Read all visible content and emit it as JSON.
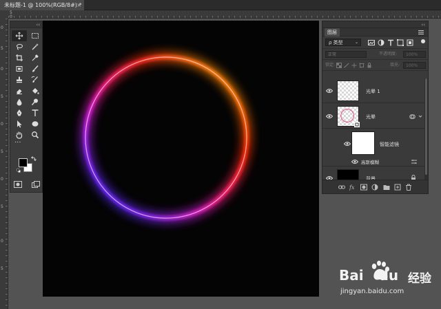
{
  "document_tab": {
    "title": "未标题-1 @ 100%(RGB/8#) *",
    "close": "×"
  },
  "rulers": {
    "top_labels": [
      "5",
      "0"
    ],
    "left_labels": [
      "0",
      "5",
      "0",
      "5",
      "0",
      "5",
      "0",
      "5",
      "0",
      "5"
    ]
  },
  "toolbox": {
    "collapse": "‹‹",
    "tools": [
      "move-tool-icon",
      "marquee-tool-icon",
      "lasso-tool-icon",
      "magic-wand-tool-icon",
      "crop-tool-icon",
      "eyedropper-tool-icon",
      "frame-tool-icon",
      "brush-tool-icon",
      "stamp-tool-icon",
      "history-brush-tool-icon",
      "eraser-tool-icon",
      "paint-bucket-tool-icon",
      "blur-tool-icon",
      "dodge-tool-icon",
      "pen-tool-icon",
      "type-tool-icon",
      "path-select-tool-icon",
      "ellipse-tool-icon",
      "hand-tool-icon",
      "zoom-tool-icon"
    ],
    "more": "···",
    "foreground_color": "#000000",
    "background_color": "#ffffff"
  },
  "canvas": {
    "background": "#040404",
    "ring_colors": [
      "#ff2a00",
      "#ff9900",
      "#ff1f6a",
      "#cc1fd8",
      "#4a2bff",
      "#a51bff"
    ]
  },
  "layers_panel": {
    "collapse": "‹‹",
    "tab_label": "图层",
    "kind_filter": "ρ 类型",
    "blend_mode": "正常",
    "opacity_label": "不透明度:",
    "opacity_value": "100%",
    "lock_label": "锁定:",
    "fill_label": "填充:",
    "fill_value": "100%",
    "layers": [
      {
        "name": "光晕 1"
      },
      {
        "name": "光晕"
      },
      {
        "name": "智能滤镜"
      },
      {
        "name": "高斯模糊"
      },
      {
        "name": "背景"
      }
    ]
  },
  "watermark": {
    "brand": "Bai",
    "brand_suffix": "du",
    "product": "经验",
    "url": "jingyan.baidu.com"
  }
}
